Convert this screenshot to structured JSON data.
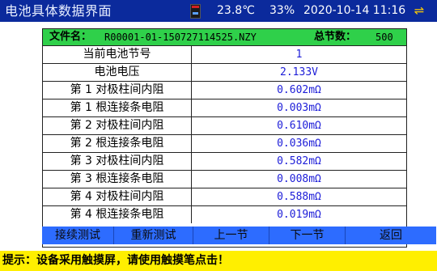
{
  "title": "电池具体数据界面",
  "status": {
    "temperature": "23.8℃",
    "battery": "33%",
    "datetime": "2020-10-14 11:16"
  },
  "file": {
    "label": "文件名：",
    "value": "R00001-01-150727114525.NZY",
    "total_label": "总节数：",
    "total_value": "500"
  },
  "rows": [
    {
      "label": "当前电池节号",
      "value": "1"
    },
    {
      "label": "电池电压",
      "value": "2.133V"
    },
    {
      "label": "第 1 对极柱间内阻",
      "value": "0.602mΩ"
    },
    {
      "label": "第 1 根连接条电阻",
      "value": "0.003mΩ"
    },
    {
      "label": "第 2 对极柱间内阻",
      "value": "0.610mΩ"
    },
    {
      "label": "第 2 根连接条电阻",
      "value": "0.036mΩ"
    },
    {
      "label": "第 3 对极柱间内阻",
      "value": "0.582mΩ"
    },
    {
      "label": "第 3 根连接条电阻",
      "value": "0.008mΩ"
    },
    {
      "label": "第 4 对极柱间内阻",
      "value": "0.588mΩ"
    },
    {
      "label": "第 4 根连接条电阻",
      "value": "0.019mΩ"
    }
  ],
  "buttons": [
    "接续测试",
    "重新测试",
    "上一节",
    "下一节",
    "返回"
  ],
  "hint": "提示：设备采用触摸屏，请使用触摸笔点击！",
  "colors": {
    "titlebar": "#0b2a9c",
    "file_row": "#2fd04a",
    "value_text": "#1d1dd8",
    "button_bar": "#2d6cff",
    "hint_bar": "#ffef00"
  },
  "icons": {
    "storage": "sd-card-icon",
    "usb": "usb-icon"
  }
}
